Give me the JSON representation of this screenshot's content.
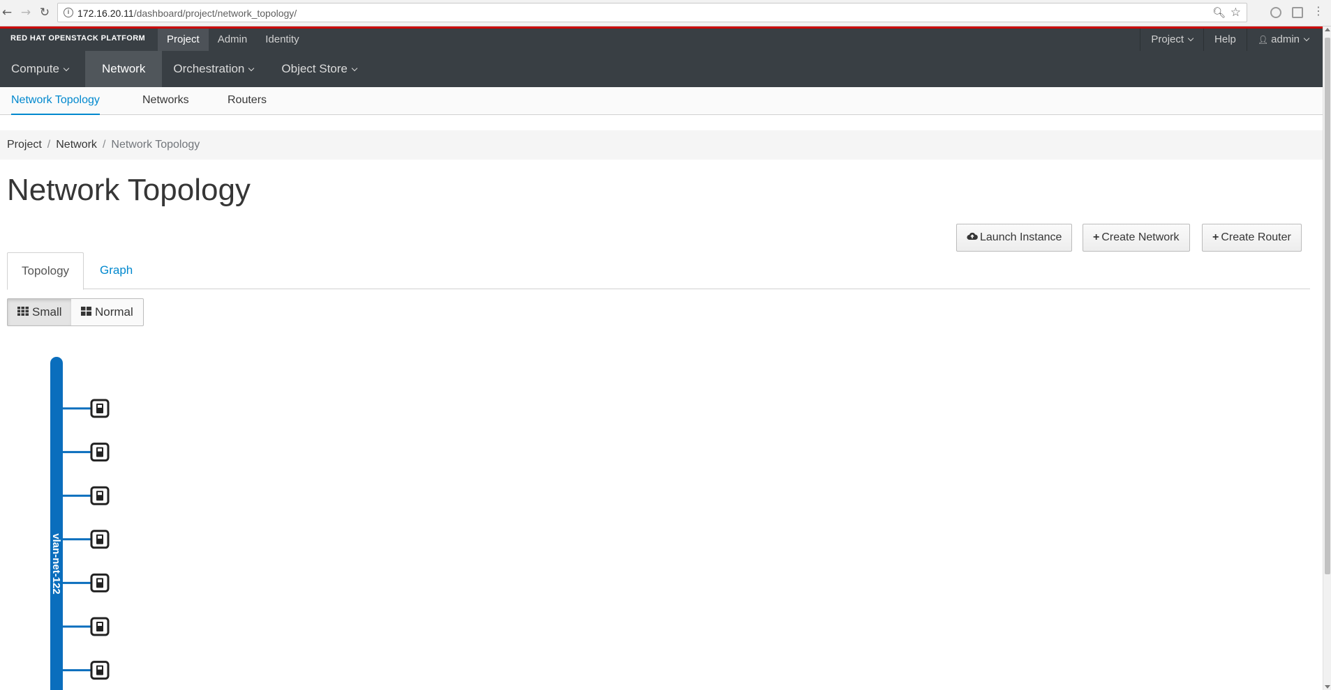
{
  "browser": {
    "url_host": "172.16.20.11",
    "url_path": "/dashboard/project/network_topology/"
  },
  "header": {
    "brand": "RED HAT OPENSTACK PLATFORM",
    "tabs": [
      "Project",
      "Admin",
      "Identity"
    ],
    "project_menu": "Project",
    "help": "Help",
    "user": "admin"
  },
  "nav": {
    "items": [
      "Compute",
      "Network",
      "Orchestration",
      "Object Store"
    ]
  },
  "subnav": {
    "items": [
      "Network Topology",
      "Networks",
      "Routers"
    ]
  },
  "breadcrumb": {
    "items": [
      "Project",
      "Network",
      "Network Topology"
    ]
  },
  "page": {
    "title": "Network Topology"
  },
  "actions": {
    "launch": "Launch Instance",
    "create_network": "Create Network",
    "create_router": "Create Router"
  },
  "view_tabs": [
    "Topology",
    "Graph"
  ],
  "size_toggle": {
    "small": "Small",
    "normal": "Normal",
    "selected": "Small"
  },
  "topology": {
    "network_name": "vlan-net-122",
    "network_color": "#0a6ebd",
    "instance_count": 7
  },
  "colors": {
    "accent_blue": "#0088ce",
    "header_dark": "#393f44",
    "brand_red": "#cc0000"
  }
}
